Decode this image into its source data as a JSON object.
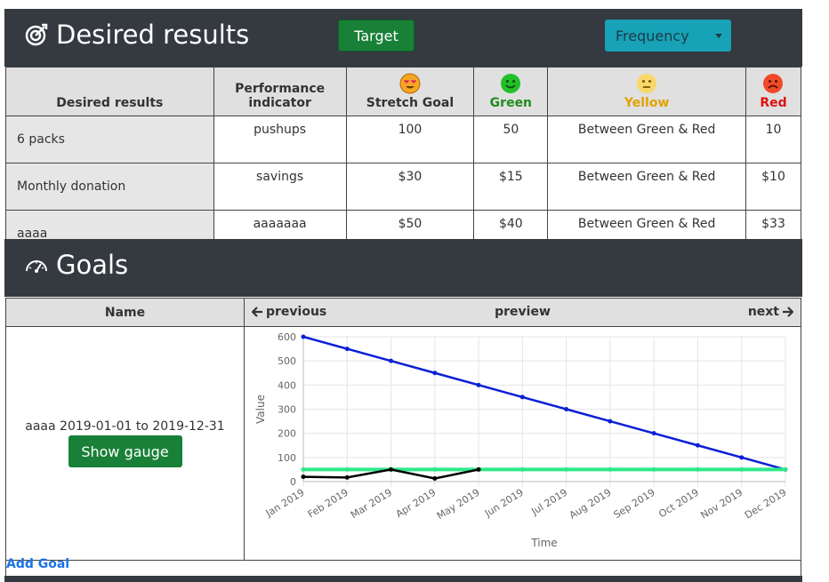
{
  "desired_results": {
    "title": "Desired results",
    "target_button": "Target",
    "frequency_button": "Frequency",
    "columns": {
      "desired_results": "Desired results",
      "performance_indicator_line1": "Performance",
      "performance_indicator_line2": "indicator",
      "stretch_goal": "Stretch Goal",
      "green": "Green",
      "yellow": "Yellow",
      "red": "Red"
    },
    "rows": [
      {
        "name": "6 packs",
        "indicator": "pushups",
        "stretch": "100",
        "green": "50",
        "yellow": "Between Green & Red",
        "red": "10"
      },
      {
        "name": "Monthly donation",
        "indicator": "savings",
        "stretch": "$30",
        "green": "$15",
        "yellow": "Between Green & Red",
        "red": "$10"
      },
      {
        "name": "aaaa",
        "indicator": "aaaaaaa",
        "stretch": "$50",
        "green": "$40",
        "yellow": "Between Green & Red",
        "red": "$33"
      }
    ],
    "colors": {
      "green": "#1e8c1e",
      "yellow": "#e0a200",
      "red": "#e01010"
    }
  },
  "goals": {
    "title": "Goals",
    "name_header": "Name",
    "previous": "previous",
    "preview": "preview",
    "next": "next",
    "goal_label": "aaaa 2019-01-01 to 2019-12-31",
    "show_gauge": "Show gauge",
    "add_goal": "Add Goal"
  },
  "chart_data": {
    "type": "line",
    "xlabel": "Time",
    "ylabel": "Value",
    "ylim": [
      0,
      600
    ],
    "yticks": [
      0,
      100,
      200,
      300,
      400,
      500,
      600
    ],
    "categories": [
      "Jan 2019",
      "Feb 2019",
      "Mar 2019",
      "Apr 2019",
      "May 2019",
      "Jun 2019",
      "Jul 2019",
      "Aug 2019",
      "Sep 2019",
      "Oct 2019",
      "Nov 2019",
      "Dec 2019"
    ],
    "grid": true,
    "series": [
      {
        "color": "#0a1fd6",
        "values": [
          600,
          550,
          500,
          450,
          400,
          350,
          300,
          250,
          200,
          150,
          100,
          50
        ]
      },
      {
        "color": "#2ee88a",
        "values": [
          50,
          50,
          50,
          50,
          50,
          50,
          50,
          50,
          50,
          50,
          50,
          50
        ]
      },
      {
        "color": "#000000",
        "values": [
          20,
          17,
          50,
          13,
          50
        ]
      }
    ]
  }
}
